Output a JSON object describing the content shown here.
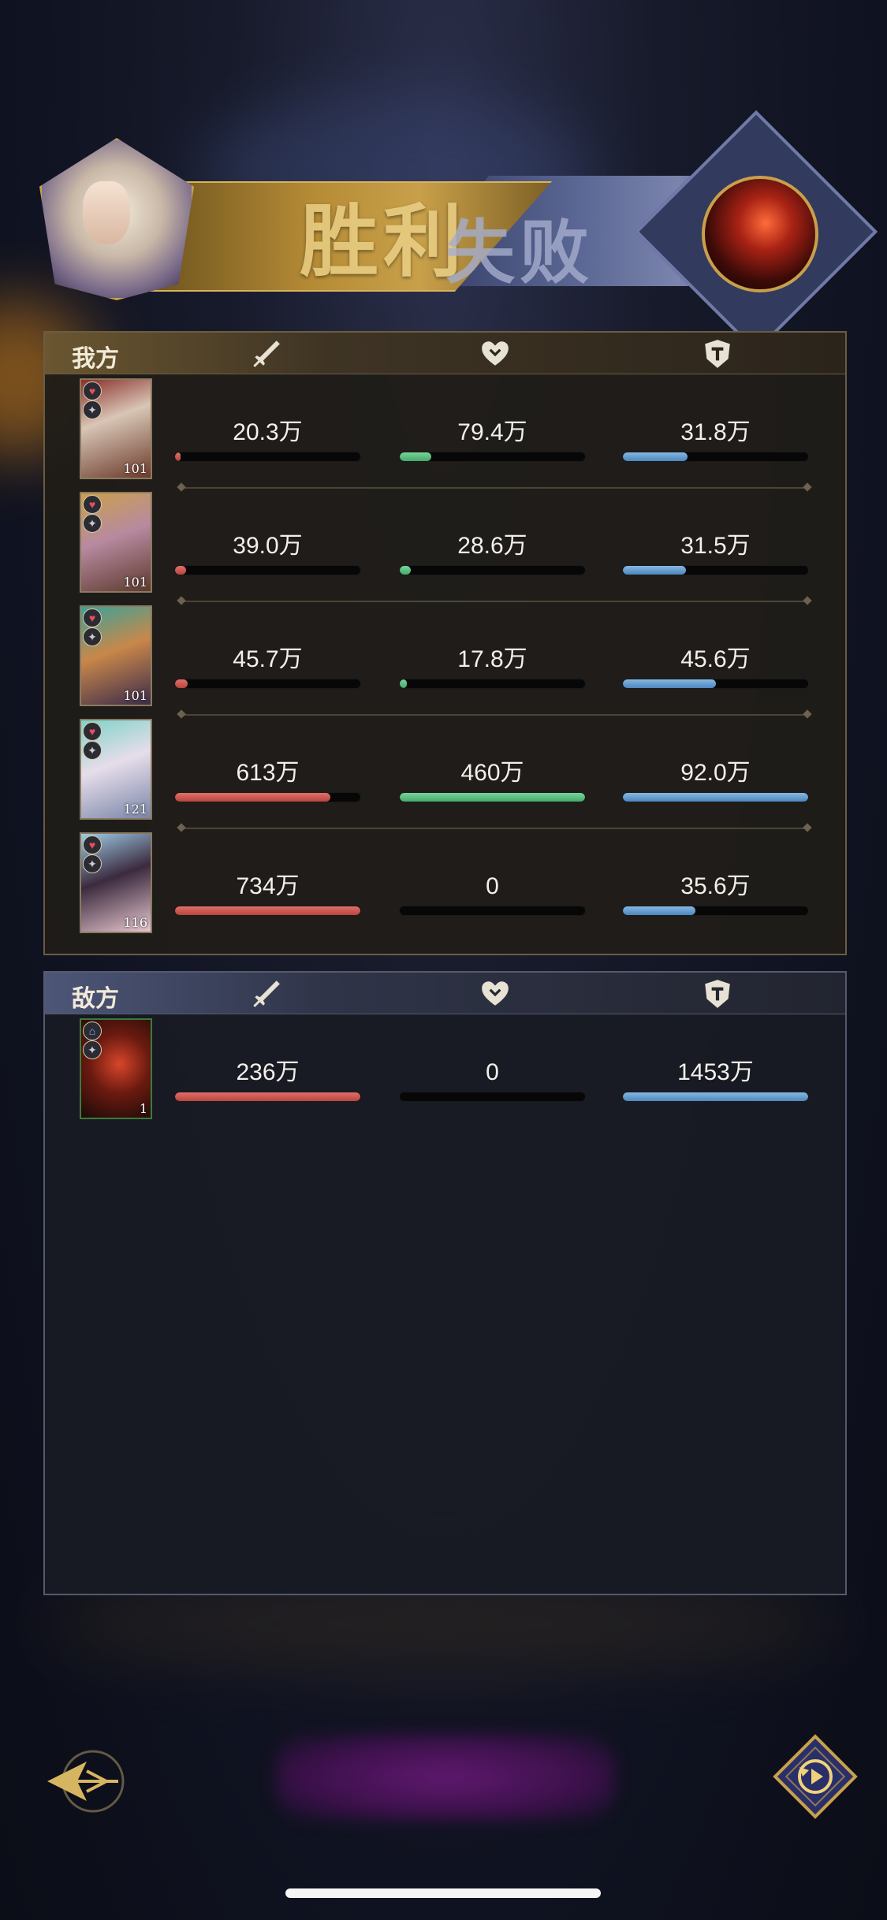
{
  "banner": {
    "win_text": "胜利",
    "lose_text": "失败"
  },
  "my_side": {
    "title": "我方",
    "rows": [
      {
        "level": "101",
        "attack": "20.3万",
        "attack_pct": 0.03,
        "heal": "79.4万",
        "heal_pct": 0.17,
        "defense": "31.8万",
        "defense_pct": 0.35
      },
      {
        "level": "101",
        "attack": "39.0万",
        "attack_pct": 0.06,
        "heal": "28.6万",
        "heal_pct": 0.06,
        "defense": "31.5万",
        "defense_pct": 0.34
      },
      {
        "level": "101",
        "attack": "45.7万",
        "attack_pct": 0.07,
        "heal": "17.8万",
        "heal_pct": 0.04,
        "defense": "45.6万",
        "defense_pct": 0.5
      },
      {
        "level": "121",
        "attack": "613万",
        "attack_pct": 0.84,
        "heal": "460万",
        "heal_pct": 1.0,
        "defense": "92.0万",
        "defense_pct": 1.0
      },
      {
        "level": "116",
        "attack": "734万",
        "attack_pct": 1.0,
        "heal": "0",
        "heal_pct": 0,
        "defense": "35.6万",
        "defense_pct": 0.39
      }
    ]
  },
  "enemy_side": {
    "title": "敌方",
    "rows": [
      {
        "level": "1",
        "attack": "236万",
        "attack_pct": 1.0,
        "heal": "0",
        "heal_pct": 0,
        "defense": "1453万",
        "defense_pct": 1.0
      }
    ]
  },
  "colors": {
    "attack": "#d45a54",
    "heal": "#5cc483",
    "defense": "#6aa1d4"
  },
  "icons": {
    "attack": "sword-icon",
    "heal": "heart-icon",
    "defense": "shield-icon"
  }
}
